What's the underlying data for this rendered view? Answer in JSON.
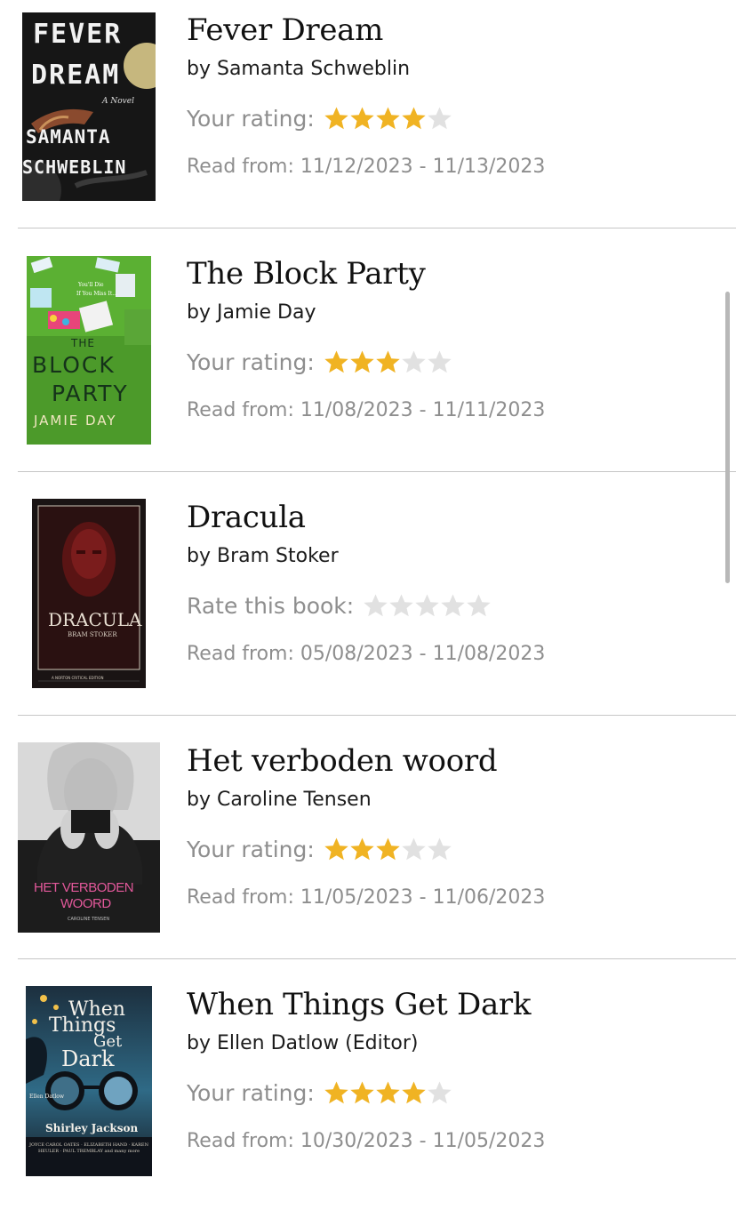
{
  "books": [
    {
      "title": "Fever Dream",
      "author": "by Samanta Schweblin",
      "rating_label": "Your rating:",
      "rating": 4,
      "read_dates": "Read from: 11/12/2023 - 11/13/2023",
      "cover": {
        "line1": "FEVER",
        "line2": "DREAM",
        "subtitle": "A Novel",
        "author1": "SAMANTA",
        "author2": "SCHWEBLIN",
        "bg": "#141414",
        "text_color": "#f2f2f2"
      }
    },
    {
      "title": "The Block Party",
      "author": "by Jamie Day",
      "rating_label": "Your rating:",
      "rating": 3,
      "read_dates": "Read from: 11/08/2023 - 11/11/2023",
      "cover": {
        "tagline1": "You'll Die",
        "tagline2": "If You Miss It...",
        "the": "THE",
        "block": "BLOCK",
        "party": "PARTY",
        "author": "JAMIE DAY",
        "bg": "#4f9a2c",
        "text_color": "#15321a"
      }
    },
    {
      "title": "Dracula",
      "author": "by Bram Stoker",
      "rating_label": "Rate this book:",
      "rating": 0,
      "read_dates": "Read from: 05/08/2023 - 11/08/2023",
      "cover": {
        "title": "DRACULA",
        "author": "BRAM STOKER",
        "edition": "A NORTON CRITICAL EDITION",
        "bg": "#1a1414",
        "text_color": "#e8dfd2"
      }
    },
    {
      "title": "Het verboden woord",
      "author": "by Caroline Tensen",
      "rating_label": "Your rating:",
      "rating": 3,
      "read_dates": "Read from: 11/05/2023 - 11/06/2023",
      "cover": {
        "title1": "HET VERBODEN",
        "title2": "WOORD",
        "author": "CAROLINE TENSEN",
        "bg": "#1e1e1e",
        "title_color": "#e2589a"
      }
    },
    {
      "title": "When Things Get Dark",
      "author": "by Ellen Datlow (Editor)",
      "rating_label": "Your rating:",
      "rating": 4,
      "read_dates": "Read from: 10/30/2023 - 11/05/2023",
      "cover": {
        "when": "When",
        "things": "Things",
        "get": "Get",
        "dark": "Dark",
        "editor": "Ellen Datlow",
        "tribute": "Shirley Jackson",
        "contributors": "JOYCE CAROL OATES · ELIZABETH HAND · KAREN HEULER · PAUL TREMBLAY and many more",
        "bg": "#1f3d52",
        "text_color": "#f4f1ea"
      }
    }
  ],
  "colors": {
    "star_filled": "#f0b323",
    "star_empty": "#e1e1e1",
    "divider": "#c6c6c6",
    "muted_text": "#8e8e8e"
  }
}
